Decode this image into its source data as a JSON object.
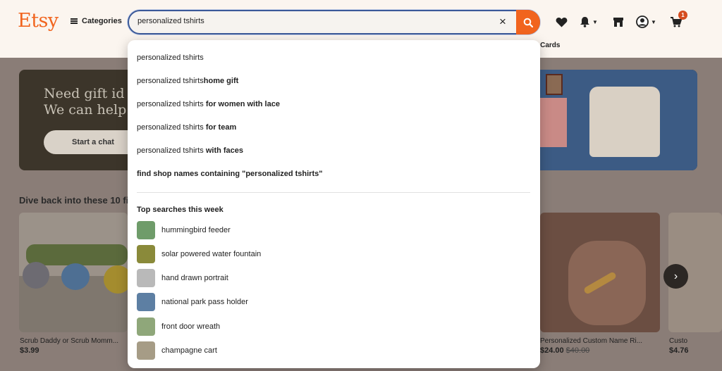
{
  "brand": {
    "logo": "Etsy",
    "accent": "#f1641e"
  },
  "header": {
    "categories_label": "Categories",
    "search_value": "personalized tshirts",
    "cart_count": "1",
    "subnav_text": "t Cards"
  },
  "hero": {
    "line1": "Need gift id",
    "line2": "We can help",
    "chat_label": "Start a chat"
  },
  "section": {
    "title": "Dive back into these 10 fi"
  },
  "products": [
    {
      "title": "Scrub Daddy or Scrub Momm...",
      "price": "$3.99",
      "old_price": ""
    },
    {
      "title": "Personalized Custom Name Ri...",
      "price": "$24.00",
      "old_price": "$40.00"
    },
    {
      "title": "Custo",
      "price": "$4.76",
      "old_price": ""
    }
  ],
  "suggestions": [
    {
      "base": "personalized tshirts",
      "bold": ""
    },
    {
      "base": "personalized tshirts",
      "bold": "home gift"
    },
    {
      "base": "personalized tshirts ",
      "bold": "for women with lace"
    },
    {
      "base": "personalized tshirts ",
      "bold": "for team"
    },
    {
      "base": "personalized tshirts ",
      "bold": "with faces"
    },
    {
      "base": "",
      "bold": "find shop names containing \"personalized tshirts\""
    }
  ],
  "top_searches": {
    "title": "Top searches this week",
    "items": [
      {
        "label": "hummingbird feeder",
        "color": "#6f9c6a"
      },
      {
        "label": "solar powered water fountain",
        "color": "#8a8a3a"
      },
      {
        "label": "hand drawn portrait",
        "color": "#b9b9b9"
      },
      {
        "label": "national park pass holder",
        "color": "#5d7fa3"
      },
      {
        "label": "front door wreath",
        "color": "#8fa77a"
      },
      {
        "label": "champagne cart",
        "color": "#a69c86"
      }
    ]
  }
}
